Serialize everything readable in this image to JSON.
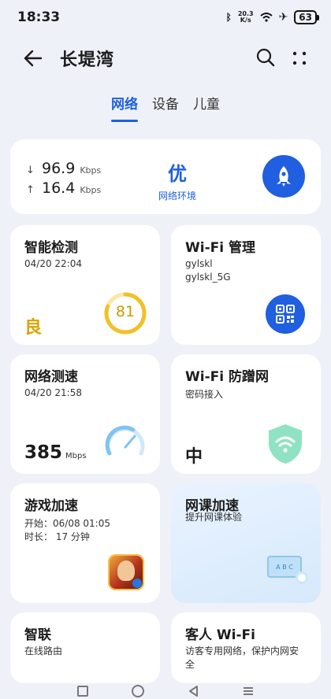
{
  "status": {
    "time": "18:33",
    "net_speed": "20.3",
    "net_unit": "K/s",
    "battery": "63"
  },
  "header": {
    "title": "长堤湾"
  },
  "tabs": [
    {
      "label": "网络"
    },
    {
      "label": "设备"
    },
    {
      "label": "儿童"
    }
  ],
  "speed": {
    "down_value": "96.9",
    "down_unit": "Kbps",
    "up_value": "16.4",
    "up_unit": "Kbps",
    "quality": "优",
    "quality_label": "网络环境"
  },
  "cards": {
    "smart_check": {
      "title": "智能检测",
      "date": "04/20 22:04",
      "grade": "良",
      "score": "81"
    },
    "wifi_manage": {
      "title": "Wi-Fi 管理",
      "ssid1": "gylskl",
      "ssid2": "gylskl_5G"
    },
    "speed_test": {
      "title": "网络测速",
      "date": "04/20 21:58",
      "value": "385",
      "unit": "Mbps"
    },
    "wifi_guard": {
      "title": "Wi-Fi 防蹭网",
      "subtitle": "密码接入",
      "level": "中"
    },
    "game_boost": {
      "title": "游戏加速",
      "start": "开始：06/08 01:05",
      "duration": "时长：  17 分钟"
    },
    "class_boost": {
      "title": "网课加速",
      "subtitle": "提升网课体验",
      "board_text": "A B C"
    },
    "smart_link": {
      "title": "智联",
      "subtitle": "在线路由"
    },
    "guest_wifi": {
      "title": "客人 Wi-Fi",
      "subtitle1": "访客专用网络，保护内网安",
      "subtitle2": "全"
    }
  },
  "colors": {
    "accent": "#1f5fe0",
    "score_yellow": "#f2c128",
    "grade_yellow": "#d9a400",
    "guard_green": "#5fd3a8",
    "gauge_blue": "#7fc4f2"
  }
}
